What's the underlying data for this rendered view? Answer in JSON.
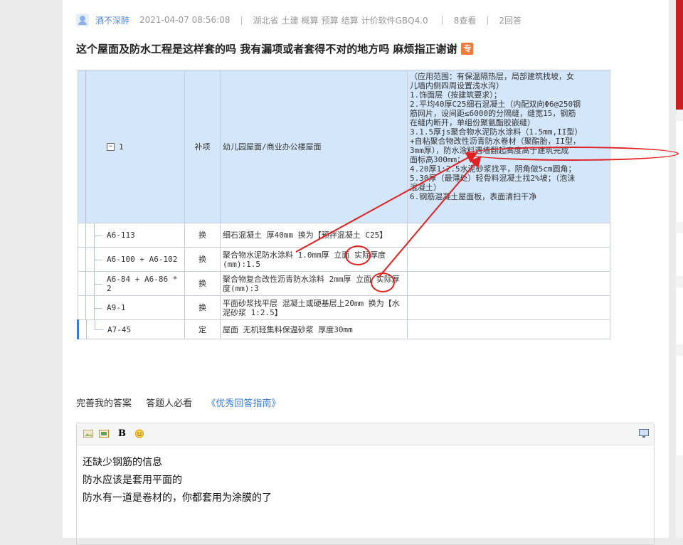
{
  "question": {
    "user": "酒不深醉",
    "datetime": "2021-04-07 08:56:08",
    "region": "湖北省",
    "categories": [
      "土建",
      "概算",
      "预算",
      "结算",
      "计价软件GBQ4.0"
    ],
    "views": "8查看",
    "answers": "2回答",
    "title": "这个屋面及防水工程是这样套的吗 我有漏项或者套得不对的地方吗 麻烦指正谢谢",
    "badge": "专"
  },
  "table": {
    "head": {
      "number": "1",
      "type": "补项",
      "name": "幼儿园屋面/商业办公楼屋面",
      "desc_lines": [
        "（应用范围：有保温隔热层，局部建筑找坡，女",
        "儿墙内侧四周设置浅水沟）",
        "1.饰面层（按建筑要求）；",
        "2.平均40厚C25细石混凝土（内配双向Φ6@250钢",
        "筋网片，设间距≤6000的分隔缝，缝宽15，钢筋",
        "在缝内断开，单组份聚氨酯胶嵌缝）",
        "3.1.5厚js聚合物水泥防水涂料（1.5mm,II型）",
        "+自粘聚合物改性沥青防水卷材（聚酯胎，II型，",
        "3mm厚），防水涂料遇墙翻起高度高于建筑完成",
        "面标高300mm；",
        "4.20厚1:2.5水泥砂浆找平，阴角做5cm圆角；",
        "5.30厚（最薄处）轻骨料混凝土找2%坡；（泡沫",
        "混凝土）",
        "6.钢筋混凝土屋面板，表面清扫干净"
      ]
    },
    "rows": [
      {
        "code": "A6-113",
        "type": "换",
        "desc": "细石混凝土 厚40mm  换为【预拌混凝土 C25】"
      },
      {
        "code": "A6-100 + A6-102",
        "type": "换",
        "desc": "聚合物水泥防水涂料 1.0mm厚 立面  实际厚度(mm):1.5"
      },
      {
        "code": "A6-84 + A6-86 * 2",
        "type": "换",
        "desc": "聚合物复合改性沥青防水涂料 2mm厚 立面  实际厚度(mm):3"
      },
      {
        "code": "A9-1",
        "type": "换",
        "desc": "平面砂浆找平层 混凝土或硬基层上20mm  换为【水泥砂浆 1:2.5】"
      },
      {
        "code": "A7-45",
        "type": "定",
        "desc": "屋面 无机轻集料保温砂浆 厚度30mm"
      }
    ]
  },
  "links": {
    "improve": "完善我的答案",
    "must_see": "答题人必看",
    "guide": "《优秀回答指南》"
  },
  "editor": {
    "bold": "B",
    "lines": [
      "还缺少钢筋的信息",
      "防水应该是套用平面的",
      "防水有一道是卷材的，你都套用为涂膜的了"
    ]
  },
  "colors": {
    "annotation": "#e02222",
    "header_row": "#d4e6fa",
    "link": "#3a7bd5"
  }
}
